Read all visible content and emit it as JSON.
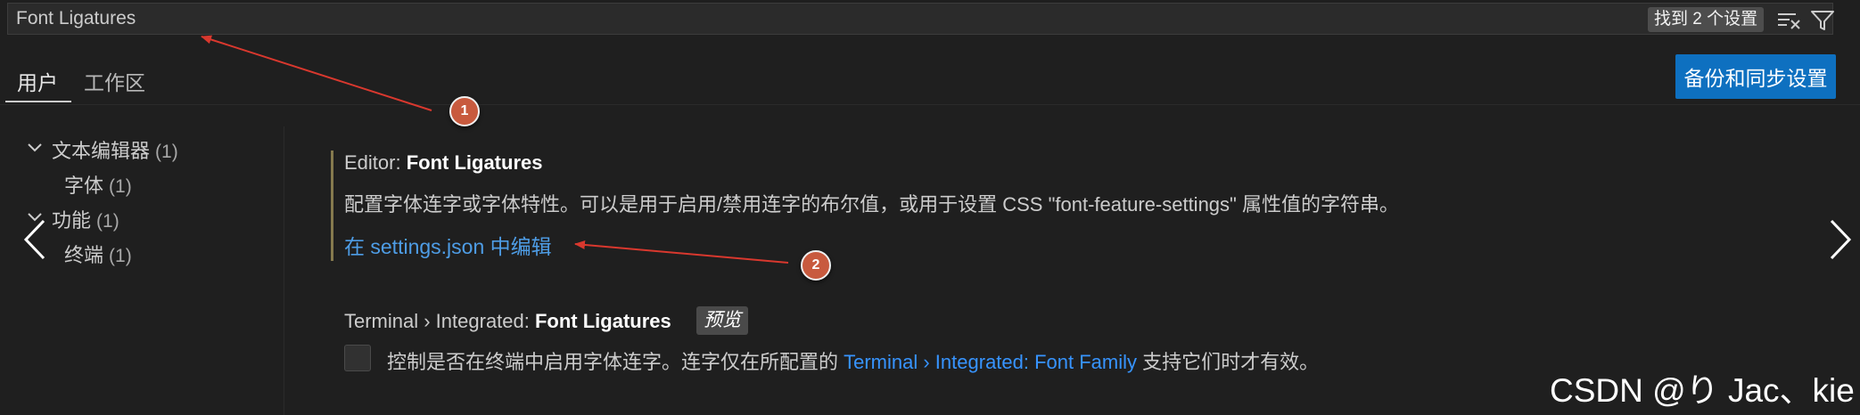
{
  "search": {
    "value": "Font Ligatures",
    "result_badge": "找到 2 个设置"
  },
  "tabs": {
    "user": "用户",
    "workspace": "工作区"
  },
  "sync_button": "备份和同步设置",
  "toc": [
    {
      "label": "文本编辑器",
      "count": "(1)"
    },
    {
      "label": "字体",
      "count": "(1)"
    },
    {
      "label": "功能",
      "count": "(1)"
    },
    {
      "label": "终端",
      "count": "(1)"
    }
  ],
  "settings": {
    "editor": {
      "prefix": "Editor: ",
      "name": "Font Ligatures",
      "description": "配置字体连字或字体特性。可以是用于启用/禁用连字的布尔值，或用于设置 CSS \"font-feature-settings\" 属性值的字符串。",
      "edit_link": "在 settings.json 中编辑"
    },
    "terminal": {
      "prefix": "Terminal › Integrated: ",
      "name": "Font Ligatures",
      "badge": "预览",
      "description_before": "控制是否在终端中启用字体连字。连字仅在所配置的 ",
      "description_link": "Terminal › Integrated: Font Family",
      "description_after": " 支持它们时才有效。",
      "checked": false
    }
  },
  "callouts": [
    "1",
    "2"
  ],
  "watermark": "CSDN @り Jac、kie",
  "colors": {
    "background": "#1f1f1f",
    "accent_button": "#0e70c0",
    "link": "#3794ff",
    "modified_bar": "#867a4e",
    "annotation_arrow": "#d9382e",
    "callout": "#c85a3e"
  },
  "icons": [
    "clear-results-icon",
    "filter-icon",
    "chevron-down-icon",
    "chevron-left-icon",
    "chevron-right-icon"
  ]
}
